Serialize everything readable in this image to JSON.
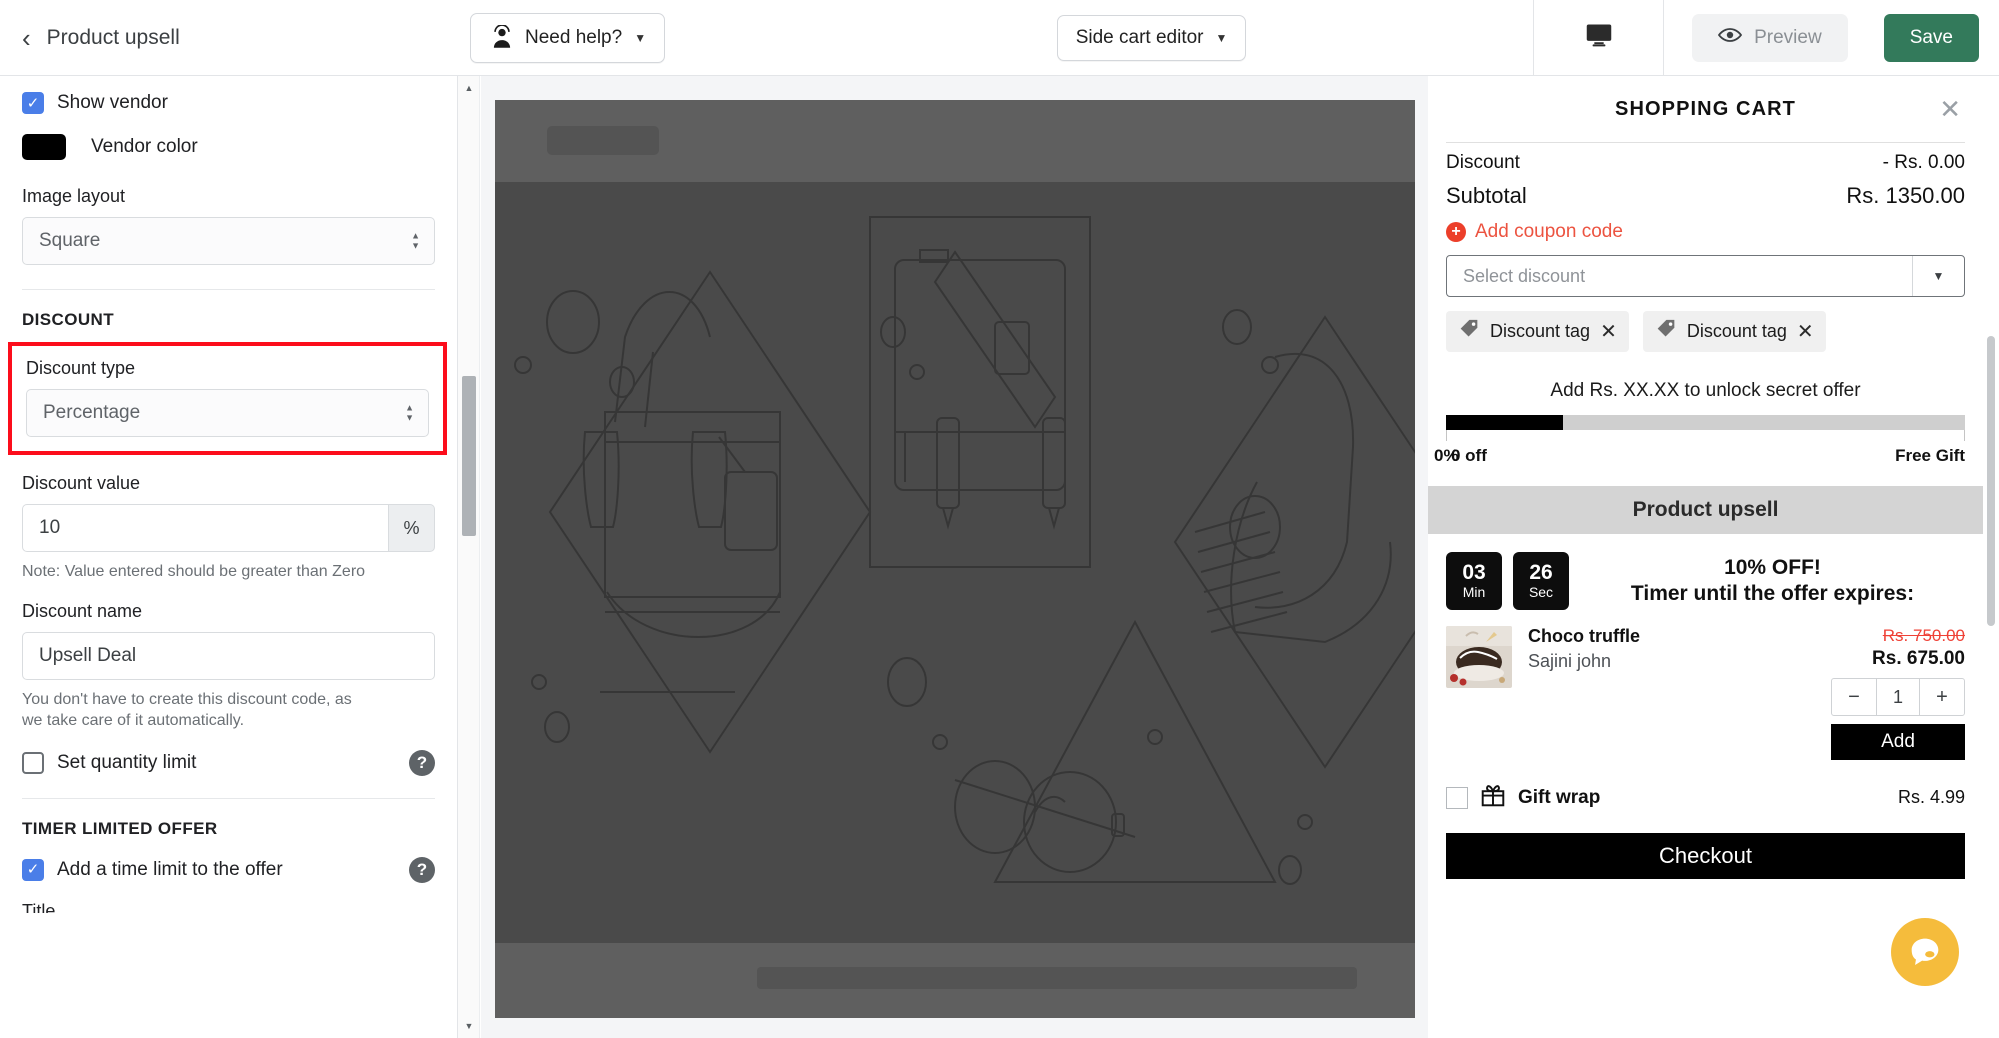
{
  "topbar": {
    "back_label": "Product upsell",
    "back_icon": "chevron-left-icon",
    "help_label": "Need help?",
    "help_icon": "person-support-icon",
    "help_caret": "▼",
    "editor_label": "Side cart editor",
    "editor_caret": "▼",
    "monitor_icon": "desktop-monitor-icon",
    "preview_label": "Preview",
    "preview_icon": "eye-icon",
    "save_label": "Save",
    "save_color": "#337a5b"
  },
  "sidebar": {
    "show_vendor_label": "Show vendor",
    "show_vendor_checked": true,
    "vendor_color_label": "Vendor color",
    "vendor_color_value": "#000000",
    "image_layout_label": "Image layout",
    "image_layout_value": "Square",
    "discount_section": "DISCOUNT",
    "discount_type_label": "Discount type",
    "discount_type_value": "Percentage",
    "discount_value_label": "Discount value",
    "discount_value": "10",
    "discount_value_suffix": "%",
    "discount_value_note": "Note: Value entered should be greater than Zero",
    "discount_name_label": "Discount name",
    "discount_name_value": "Upsell Deal",
    "discount_name_note": "You don't have to create this discount code, as we take care of it automatically.",
    "quantity_limit_label": "Set quantity limit",
    "quantity_limit_checked": false,
    "timer_section": "TIMER LIMITED OFFER",
    "time_limit_label": "Add a time limit to the offer",
    "time_limit_checked": true,
    "next_field_label": "Title",
    "highlight_color": "#fc0d1b",
    "checkbox_color": "#4a7ee8"
  },
  "cart": {
    "title": "SHOPPING CART",
    "close_icon": "close-x-icon",
    "discount_label": "Discount",
    "discount_value": "- Rs. 0.00",
    "subtotal_label": "Subtotal",
    "subtotal_value": "Rs. 1350.00",
    "add_coupon_label": "Add coupon code",
    "add_coupon_color": "#ec5340",
    "select_discount_placeholder": "Select discount",
    "tags": [
      {
        "label": "Discount tag",
        "icon": "price-tag-icon",
        "remove_icon": "close-x-icon"
      },
      {
        "label": "Discount tag",
        "icon": "price-tag-icon",
        "remove_icon": "close-x-icon"
      }
    ],
    "unlock_text": "Add Rs. XX.XX to unlock secret offer",
    "progress_percent": 22.5,
    "progress_labels_left": [
      "0%",
      "0 off"
    ],
    "progress_label_right": "Free Gift",
    "upsell_heading": "Product upsell",
    "timer": {
      "minutes": "03",
      "minutes_unit": "Min",
      "seconds": "26",
      "seconds_unit": "Sec",
      "offer_text": "10% OFF!",
      "expire_text": "Timer until the offer expires:"
    },
    "product": {
      "name": "Choco truffle",
      "vendor": "Sajini john",
      "price_old": "Rs. 750.00",
      "price_new": "Rs. 675.00",
      "qty_minus": "−",
      "qty_value": "1",
      "qty_plus": "+",
      "add_label": "Add"
    },
    "gift_wrap_label": "Gift wrap",
    "gift_wrap_price": "Rs. 4.99",
    "gift_wrap_icon": "gift-icon",
    "gift_wrap_checked": false,
    "checkout_label": "Checkout",
    "chat_icon": "chat-bubble-icon",
    "chat_color": "#f5bc3c"
  }
}
